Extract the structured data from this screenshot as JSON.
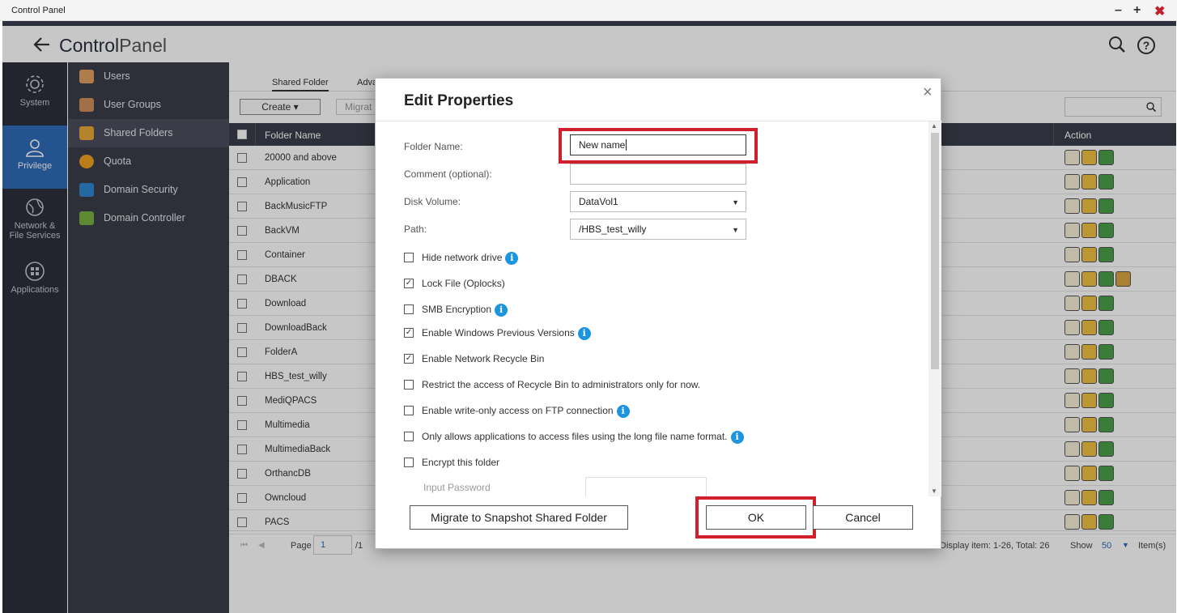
{
  "window": {
    "title": "Control Panel"
  },
  "header": {
    "title_bold": "Control",
    "title_light": "Panel"
  },
  "rail": [
    {
      "label": "System",
      "icon": "gear-icon"
    },
    {
      "label": "Privilege",
      "icon": "user-icon",
      "active": true
    },
    {
      "label": "Network &\nFile Services",
      "icon": "globe-icon"
    },
    {
      "label": "Applications",
      "icon": "apps-icon"
    }
  ],
  "subnav": [
    {
      "label": "Users",
      "color": "#e0a060"
    },
    {
      "label": "User Groups",
      "color": "#d0905a"
    },
    {
      "label": "Shared Folders",
      "color": "#e8a838",
      "active": true
    },
    {
      "label": "Quota",
      "color": "#f0a020"
    },
    {
      "label": "Domain Security",
      "color": "#2e86d0"
    },
    {
      "label": "Domain Controller",
      "color": "#78b040"
    }
  ],
  "tabs": [
    "Shared Folder",
    "Adva"
  ],
  "toolbar": {
    "create": "Create",
    "migrate": "Migrat"
  },
  "grid": {
    "col_name": "Folder Name",
    "col_action": "Action",
    "rows": [
      "20000 and above",
      "Application",
      "BackMusicFTP",
      "BackVM",
      "Container",
      "DBACK",
      "Download",
      "DownloadBack",
      "FolderA",
      "HBS_test_willy",
      "MediQPACS",
      "Multimedia",
      "MultimediaBack",
      "OrthancDB",
      "Owncloud",
      "PACS"
    ]
  },
  "pager": {
    "page_label": "Page",
    "page_value": "1",
    "page_total": "/1",
    "display": "Display item: 1-26, Total: 26",
    "show_label": "Show",
    "show_value": "50",
    "items_label": "Item(s)"
  },
  "dialog": {
    "title": "Edit Properties",
    "folder_name_label": "Folder Name:",
    "folder_name_value": "New name",
    "comment_label": "Comment (optional):",
    "comment_value": "",
    "disk_volume_label": "Disk Volume:",
    "disk_volume_value": "DataVol1",
    "path_label": "Path:",
    "path_value": "/HBS_test_willy",
    "options": [
      {
        "label": "Hide network drive",
        "checked": false,
        "info": true
      },
      {
        "label": "Lock File (Oplocks)",
        "checked": true,
        "info": false
      },
      {
        "label": "SMB Encryption",
        "checked": false,
        "info": true
      },
      {
        "label": "Enable Windows Previous Versions",
        "checked": true,
        "info": true
      },
      {
        "label": "Enable Network Recycle Bin",
        "checked": true,
        "info": false
      },
      {
        "label": "Restrict the access of Recycle Bin to administrators only for now.",
        "checked": false,
        "info": false
      },
      {
        "label": "Enable write-only access on FTP connection",
        "checked": false,
        "info": true
      },
      {
        "label": "Only allows applications to access files using the long file name format.",
        "checked": false,
        "info": true
      },
      {
        "label": "Encrypt this folder",
        "checked": false,
        "info": false
      }
    ],
    "input_password_label": "Input Password",
    "migrate_button": "Migrate to Snapshot Shared Folder",
    "ok_button": "OK",
    "cancel_button": "Cancel"
  },
  "colors": {
    "accent": "#2e6cb8",
    "highlight": "#d0202e",
    "info": "#1c95e0"
  }
}
